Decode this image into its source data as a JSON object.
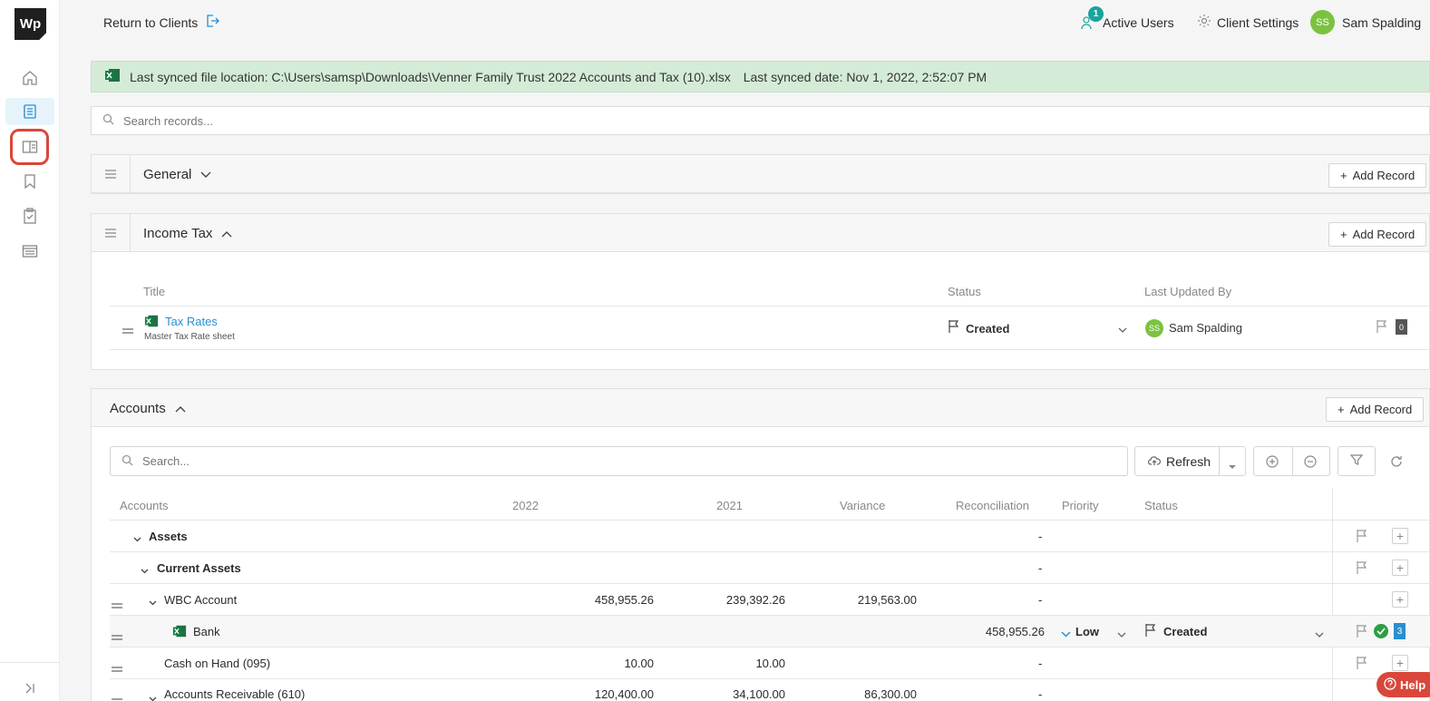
{
  "sidebar": {
    "logo": "Wp",
    "items": [
      "home-icon",
      "records-icon",
      "panel-icon",
      "bookmark-icon",
      "checklist-icon",
      "list-icon"
    ]
  },
  "header": {
    "return_label": "Return to Clients",
    "active_users_label": "Active Users",
    "active_users_count": "1",
    "client_settings_label": "Client Settings",
    "user_initials": "SS",
    "user_name": "Sam Spalding"
  },
  "sync": {
    "location": "Last synced file location: C:\\Users\\samsp\\Downloads\\Venner Family Trust 2022 Accounts and Tax (10).xlsx",
    "date": "Last synced date: Nov 1, 2022, 2:52:07 PM"
  },
  "search_records": {
    "placeholder": "Search records..."
  },
  "sections": {
    "general": {
      "title": "General",
      "add_label": "Add Record"
    },
    "income_tax": {
      "title": "Income Tax",
      "add_label": "Add Record",
      "columns": {
        "title": "Title",
        "status": "Status",
        "last_updated": "Last Updated By"
      },
      "record": {
        "title": "Tax Rates",
        "subtitle": "Master Tax Rate sheet",
        "status": "Created",
        "updated_initials": "SS",
        "updated_by": "Sam Spalding",
        "count": "0"
      }
    },
    "accounts": {
      "title": "Accounts",
      "add_label": "Add Record",
      "search_placeholder": "Search...",
      "refresh_label": "Refresh",
      "columns": {
        "accounts": "Accounts",
        "y2022": "2022",
        "y2021": "2021",
        "variance": "Variance",
        "reconciliation": "Reconciliation",
        "priority": "Priority",
        "status": "Status"
      },
      "rows": [
        {
          "name": "Assets",
          "y2022": "",
          "y2021": "",
          "variance": "",
          "reconciliation": "-"
        },
        {
          "name": "Current Assets",
          "y2022": "",
          "y2021": "",
          "variance": "",
          "reconciliation": "-"
        },
        {
          "name": "WBC Account",
          "y2022": "458,955.26",
          "y2021": "239,392.26",
          "variance": "219,563.00",
          "reconciliation": "-"
        },
        {
          "name": "Bank",
          "y2022": "",
          "y2021": "",
          "variance": "",
          "reconciliation": "458,955.26",
          "priority": "Low",
          "status": "Created",
          "count": "3"
        },
        {
          "name": "Cash on Hand (095)",
          "y2022": "10.00",
          "y2021": "10.00",
          "variance": "",
          "reconciliation": "-"
        },
        {
          "name": "Accounts Receivable (610)",
          "y2022": "120,400.00",
          "y2021": "34,100.00",
          "variance": "86,300.00",
          "reconciliation": "-"
        }
      ]
    }
  },
  "help_label": "Help",
  "colors": {
    "accent": "#2a8fd0",
    "success": "#7cc242",
    "banner": "#d4ecd7",
    "alert": "#d9473b"
  }
}
